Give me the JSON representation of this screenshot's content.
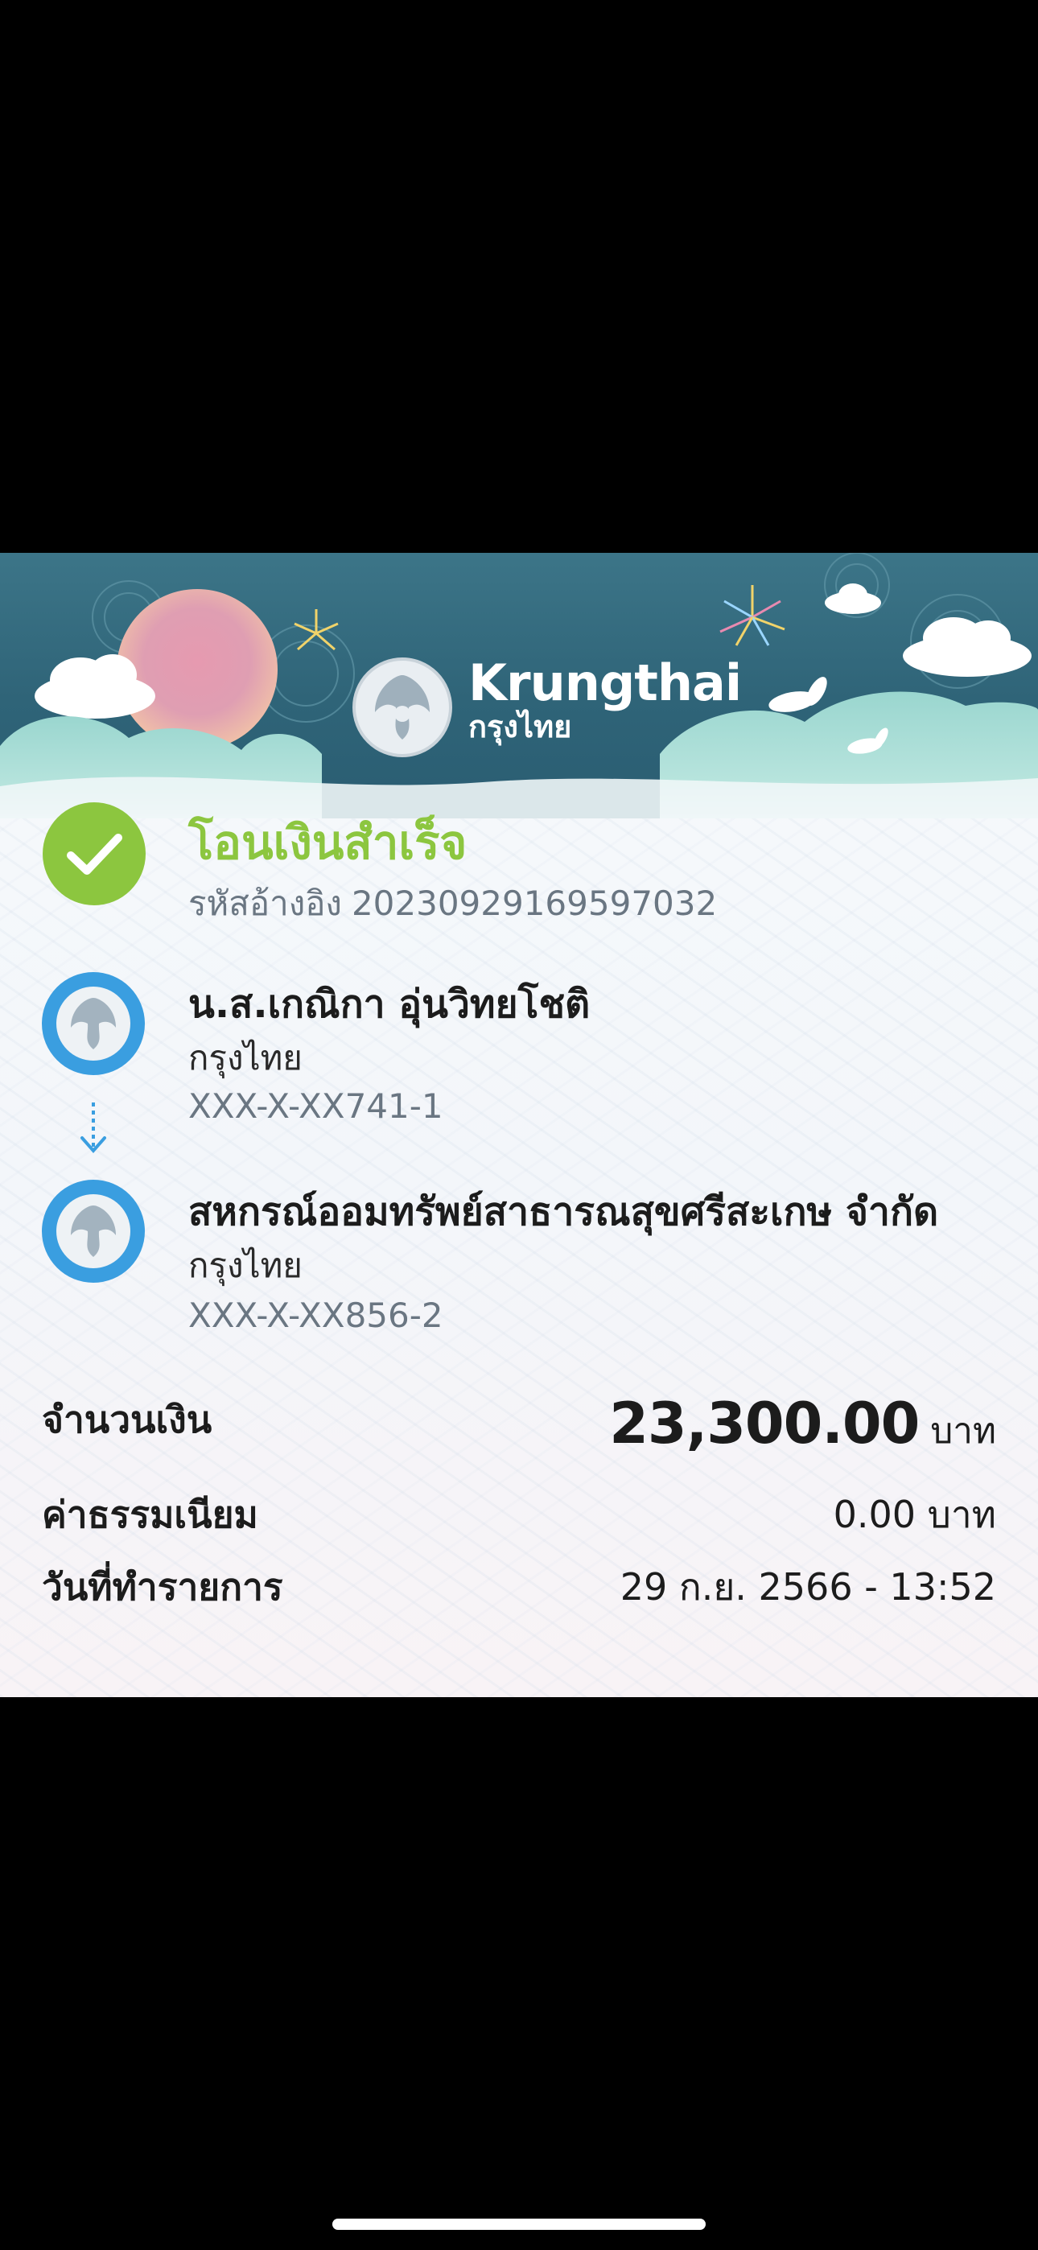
{
  "brand": {
    "name_en": "Krungthai",
    "name_th": "กรุงไทย"
  },
  "status": {
    "title": "โอนเงินสำเร็จ",
    "ref_label": "รหัสอ้างอิง",
    "ref_value": "20230929169597032"
  },
  "sender": {
    "name": "น.ส.เกณิกา อุ่นวิทยโชติ",
    "bank": "กรุงไทย",
    "account": "XXX-X-XX741-1"
  },
  "receiver": {
    "name": "สหกรณ์ออมทรัพย์สาธารณสุขศรีสะเกษ จำกัด",
    "bank": "กรุงไทย",
    "account": "XXX-X-XX856-2"
  },
  "details": {
    "amount_label": "จำนวนเงิน",
    "amount_value": "23,300.00",
    "amount_unit": "บาท",
    "fee_label": "ค่าธรรมเนียม",
    "fee_value": "0.00 บาท",
    "date_label": "วันที่ทำรายการ",
    "date_value": "29 ก.ย. 2566 - 13:52"
  },
  "colors": {
    "success_green": "#8cc63f",
    "avatar_blue": "#3a9ee0",
    "banner_teal": "#2f6a80",
    "cloud_mint": "#9fd8d2"
  },
  "icons": {
    "success": "check-circle-icon",
    "avatar": "krungthai-logo-icon",
    "transfer_arrow": "dotted-arrow-down-icon"
  }
}
